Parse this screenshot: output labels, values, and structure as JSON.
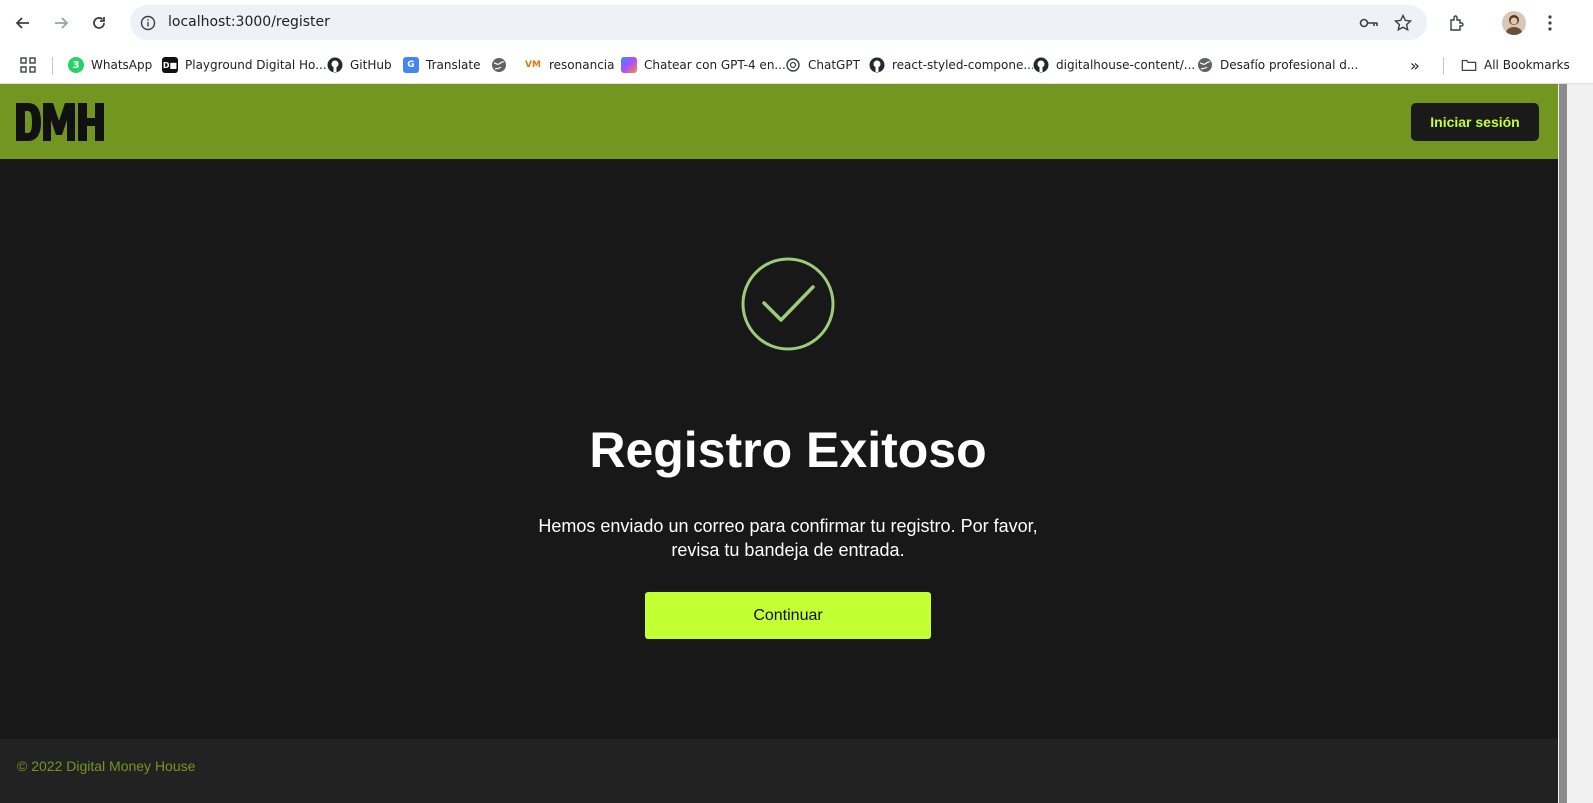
{
  "browser": {
    "url": "localhost:3000/register",
    "bookmarks": [
      {
        "label": "WhatsApp",
        "icon": "whatsapp-icon"
      },
      {
        "label": "Playground Digital Ho...",
        "icon": "dh-icon"
      },
      {
        "label": "GitHub",
        "icon": "github-icon"
      },
      {
        "label": "Translate",
        "icon": "translate-icon"
      },
      {
        "label": "",
        "icon": "globe-icon"
      },
      {
        "label": "resonancia",
        "icon": "vm-icon"
      },
      {
        "label": "Chatear con GPT-4 en...",
        "icon": "copilot-icon"
      },
      {
        "label": "ChatGPT",
        "icon": "chatgpt-icon"
      },
      {
        "label": "react-styled-compone...",
        "icon": "github-icon"
      },
      {
        "label": "digitalhouse-content/...",
        "icon": "github-icon"
      },
      {
        "label": "Desafío profesional d...",
        "icon": "globe-icon"
      }
    ],
    "all_bookmarks": "All Bookmarks"
  },
  "header": {
    "logo_alt": "DMH",
    "login_label": "Iniciar sesión"
  },
  "main": {
    "title": "Registro Exitoso",
    "message": "Hemos enviado un correo para confirmar tu registro. Por favor, revisa tu bandeja de entrada.",
    "continue_label": "Continuar"
  },
  "footer": {
    "text": "© 2022 Digital Money House"
  },
  "colors": {
    "brand_green": "#739621",
    "accent_lime": "#c2ff33",
    "success_check": "#9ccc7a",
    "background": "#181818"
  }
}
